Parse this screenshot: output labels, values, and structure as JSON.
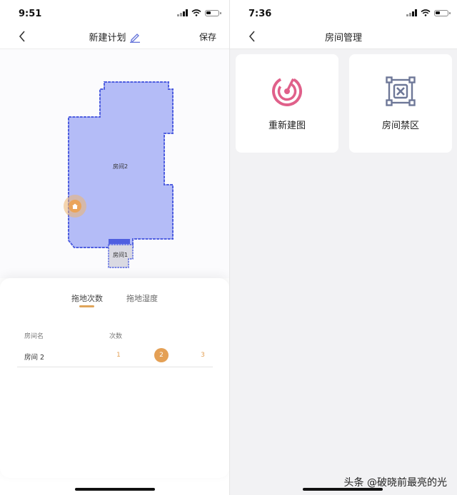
{
  "left_screen": {
    "status": {
      "time": "9:51"
    },
    "nav": {
      "title": "新建计划",
      "save": "保存"
    },
    "map": {
      "room2": "房间2",
      "room1": "房间1"
    },
    "tabs": [
      {
        "label": "拖地次数",
        "active": true
      },
      {
        "label": "拖地湿度",
        "active": false
      }
    ],
    "table": {
      "header_name": "房间名",
      "header_count": "次数",
      "rows": [
        {
          "name": "房间 2",
          "options": [
            "1",
            "2",
            "3"
          ],
          "selected": "2"
        }
      ]
    }
  },
  "right_screen": {
    "status": {
      "time": "7:36"
    },
    "nav": {
      "title": "房间管理"
    },
    "cards": [
      {
        "label": "重新建图",
        "icon": "radar-icon"
      },
      {
        "label": "房间禁区",
        "icon": "restricted-zone-icon"
      }
    ]
  },
  "watermark": "头条 @破晓前最亮的光",
  "colors": {
    "accent": "#e4a055",
    "map_fill": "#b4bcf7",
    "map_border": "#4f5fe0",
    "radar": "#e0608a",
    "zone": "#6e7898"
  }
}
